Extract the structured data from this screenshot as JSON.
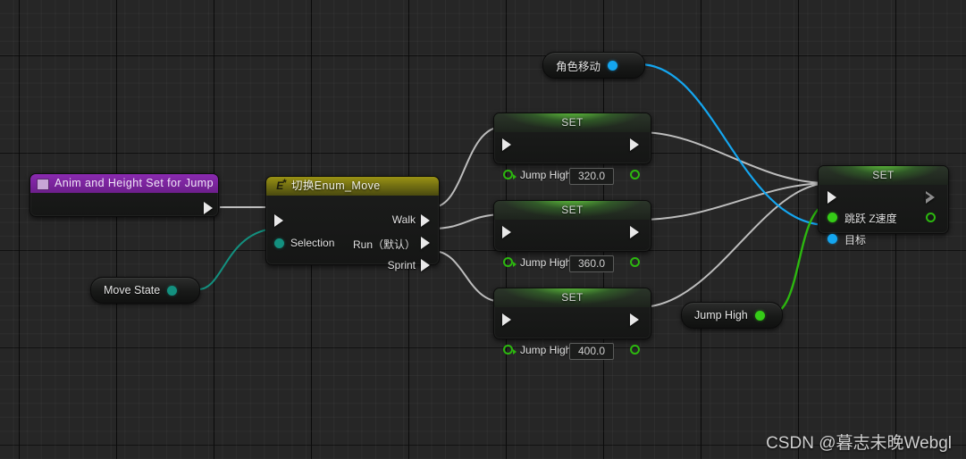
{
  "app": {
    "kind": "blueprint-graph",
    "watermark": "CSDN @暮志未晚Webgl"
  },
  "colors": {
    "exec_wire": "#bdbdbd",
    "object_wire": "#14a6f0",
    "float_wire": "#2cb70f",
    "enum_wire": "#13907f",
    "set_header_green": "#6ce140",
    "switch_header": "#9a9214",
    "comment_purple": "#8a2ab0"
  },
  "nodes": {
    "comment": {
      "title": "Anim and Height Set for Jump",
      "icon": "comment-box-icon"
    },
    "move_state": {
      "label": "Move State",
      "pin": "enum-output-pin"
    },
    "switch": {
      "title": "切换Enum_Move",
      "badge": "E",
      "input_pin_label": "Selection",
      "outputs": [
        "Walk",
        "Run（默认）",
        "Sprint"
      ]
    },
    "set_nodes": [
      {
        "title": "SET",
        "pin_label": "Jump High",
        "value": "320.0"
      },
      {
        "title": "SET",
        "pin_label": "Jump High",
        "value": "360.0"
      },
      {
        "title": "SET",
        "pin_label": "Jump High",
        "value": "400.0"
      }
    ],
    "character_movement": {
      "label": "角色移动",
      "pin": "object-output-pin"
    },
    "jump_high_getter": {
      "label": "Jump High",
      "pin": "float-output-pin"
    },
    "set_velocity": {
      "title": "SET",
      "pin_labels": [
        "跳跃 Z速度",
        "目标"
      ]
    }
  }
}
